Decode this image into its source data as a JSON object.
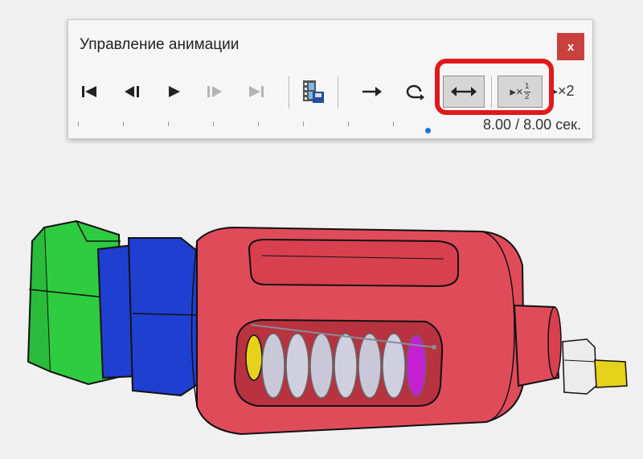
{
  "panel": {
    "title": "Управление анимации",
    "close_label": "x",
    "toolbar": {
      "buttons": [
        {
          "name": "go-to-start",
          "icon": "skip-to-start-icon"
        },
        {
          "name": "step-back",
          "icon": "step-back-icon"
        },
        {
          "name": "play",
          "icon": "play-icon"
        },
        {
          "name": "step-forward",
          "icon": "step-forward-icon",
          "disabled": true
        },
        {
          "name": "go-to-end",
          "icon": "skip-to-end-icon",
          "disabled": true
        },
        {
          "name": "save-video",
          "icon": "film-save-icon"
        },
        {
          "name": "play-once",
          "icon": "arrow-right-icon"
        },
        {
          "name": "loop",
          "icon": "loop-icon"
        },
        {
          "name": "reciprocate",
          "icon": "double-arrow-icon",
          "active": true
        },
        {
          "name": "half-speed",
          "icon": "half-speed-icon",
          "active": true
        },
        {
          "name": "double-speed",
          "icon": "double-speed-icon"
        }
      ],
      "half_speed_label": {
        "prefix": "▸×",
        "numerator": "1",
        "denominator": "2"
      },
      "double_speed_label": "▸×2"
    },
    "timeline": {
      "time_text": "8.00 / 8.00 сек.",
      "position_fraction": 1.0
    }
  },
  "colors": {
    "highlight": "#e01a1a",
    "close_bg": "#c9413e",
    "body_red": "#e04b5a",
    "nut_green": "#2ecc40",
    "collar_blue": "#1f3fd1",
    "fitting_yellow": "#e6d21a",
    "spring_grey": "#c8c8d8",
    "spring_end_magenta": "#c51fd1",
    "slider_knob": "#1a74d8"
  }
}
